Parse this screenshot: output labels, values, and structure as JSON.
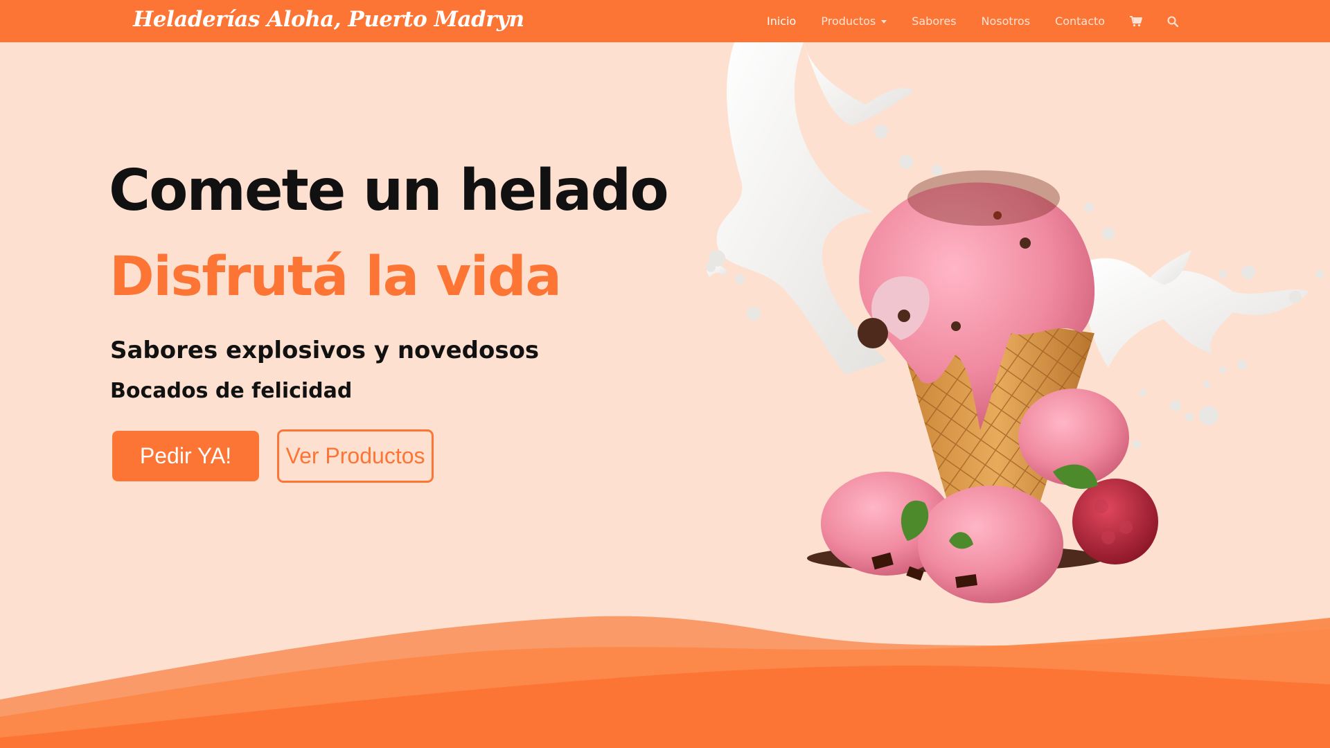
{
  "brand": {
    "name": "Heladerías Aloha, Puerto Madryn"
  },
  "nav": {
    "items": [
      {
        "label": "Inicio",
        "active": true
      },
      {
        "label": "Productos",
        "dropdown": true
      },
      {
        "label": "Sabores"
      },
      {
        "label": "Nosotros"
      },
      {
        "label": "Contacto"
      }
    ],
    "icons": [
      "cart-icon",
      "search-icon"
    ]
  },
  "hero": {
    "title": "Comete un helado",
    "subtitle": "Disfrutá la vida",
    "tagline_1": "Sabores explosivos y novedosos",
    "tagline_2": "Bocados de felicidad",
    "primary_button": "Pedir YA!",
    "secondary_button": "Ver Productos"
  },
  "colors": {
    "accent": "#fd7535",
    "background": "#fde0d0",
    "text": "#111111"
  }
}
